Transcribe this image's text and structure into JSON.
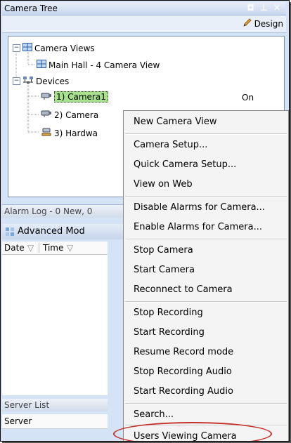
{
  "panel": {
    "title": "Camera Tree",
    "controls": "◘ ⊥ ✕",
    "design_label": "Design"
  },
  "tree": {
    "camera_views_label": "Camera Views",
    "main_hall_label": "Main Hall - 4 Camera View",
    "devices_label": "Devices",
    "camera1_label": "1) Camera1",
    "camera1_status": "On",
    "camera2_label": "2) Camera",
    "hardware_label": "3) Hardwa"
  },
  "alarm_log": {
    "title": "Alarm Log - 0 New, 0",
    "advanced_mode": "Advanced Mod",
    "col_date": "Date",
    "col_time": "Time"
  },
  "server_list": {
    "title": "Server List",
    "col_server": "Server"
  },
  "context_menu": {
    "items": [
      "New Camera View",
      "Camera Setup...",
      "Quick Camera Setup...",
      "View on Web",
      "Disable Alarms for Camera...",
      "Enable Alarms for Camera...",
      "Stop Camera",
      "Start Camera",
      "Reconnect to Camera",
      "Stop Recording",
      "Start Recording",
      "Resume Record mode",
      "Stop Recording Audio",
      "Start Recording Audio",
      "Search...",
      "Users Viewing Camera"
    ]
  },
  "colors": {
    "selection": "#a8e28c",
    "highlight_ring": "#c4302b"
  }
}
